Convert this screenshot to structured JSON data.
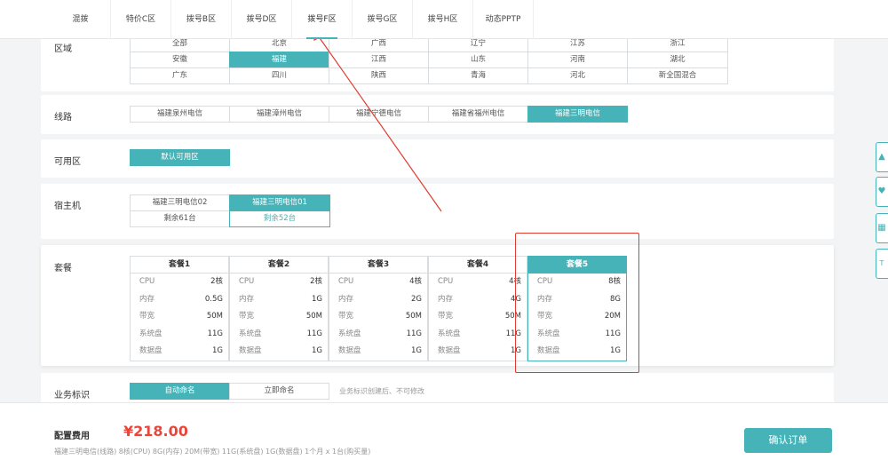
{
  "tabs": [
    "混拨",
    "特价C区",
    "拨号B区",
    "拨号D区",
    "拨号F区",
    "拨号G区",
    "拨号H区",
    "动态PPTP"
  ],
  "region": {
    "label": "区域",
    "rows": [
      [
        "全部",
        "北京",
        "广西",
        "辽宁",
        "江苏",
        "浙江"
      ],
      [
        "安徽",
        "福建",
        "江西",
        "山东",
        "河南",
        "湖北"
      ],
      [
        "广东",
        "四川",
        "陕西",
        "青海",
        "河北",
        "新全国混合"
      ]
    ]
  },
  "line": {
    "label": "线路",
    "options": [
      "福建泉州电信",
      "福建漳州电信",
      "福建宁德电信",
      "福建省福州电信",
      "福建三明电信"
    ]
  },
  "zone": {
    "label": "可用区",
    "options": [
      "默认可用区"
    ]
  },
  "host": {
    "label": "宿主机",
    "options": [
      {
        "name": "福建三明电信02",
        "remaining": "剩余61台"
      },
      {
        "name": "福建三明电信01",
        "remaining": "剩余52台"
      }
    ]
  },
  "package": {
    "label": "套餐",
    "items": [
      {
        "name": "套餐1",
        "rows": [
          [
            "CPU",
            "2核"
          ],
          [
            "内存",
            "0.5G"
          ],
          [
            "带宽",
            "50M"
          ],
          [
            "系统盘",
            "11G"
          ],
          [
            "数据盘",
            "1G"
          ]
        ]
      },
      {
        "name": "套餐2",
        "rows": [
          [
            "CPU",
            "2核"
          ],
          [
            "内存",
            "1G"
          ],
          [
            "带宽",
            "50M"
          ],
          [
            "系统盘",
            "11G"
          ],
          [
            "数据盘",
            "1G"
          ]
        ]
      },
      {
        "name": "套餐3",
        "rows": [
          [
            "CPU",
            "4核"
          ],
          [
            "内存",
            "2G"
          ],
          [
            "带宽",
            "50M"
          ],
          [
            "系统盘",
            "11G"
          ],
          [
            "数据盘",
            "1G"
          ]
        ]
      },
      {
        "name": "套餐4",
        "rows": [
          [
            "CPU",
            "4核"
          ],
          [
            "内存",
            "4G"
          ],
          [
            "带宽",
            "50M"
          ],
          [
            "系统盘",
            "11G"
          ],
          [
            "数据盘",
            "1G"
          ]
        ]
      },
      {
        "name": "套餐5",
        "rows": [
          [
            "CPU",
            "8核"
          ],
          [
            "内存",
            "8G"
          ],
          [
            "带宽",
            "20M"
          ],
          [
            "系统盘",
            "11G"
          ],
          [
            "数据盘",
            "1G"
          ]
        ]
      }
    ]
  },
  "business": {
    "label": "业务标识",
    "options": [
      "自动命名",
      "立即命名"
    ],
    "note": "业务标识创建后、不可修改"
  },
  "footer": {
    "fee_label": "配置费用",
    "price": "¥218.00",
    "summary": "福建三明电信(线路) 8核(CPU) 8G(内存) 20M(带宽) 11G(系统盘) 1G(数据盘) 1个月 x 1台(购买量)",
    "confirm": "确认订单"
  },
  "side_icons": [
    "tree-icon",
    "heart-icon",
    "qr-icon",
    "text-icon"
  ],
  "colors": {
    "accent": "#45b3b7",
    "price": "#e8463a",
    "annotation": "#e03c31"
  }
}
